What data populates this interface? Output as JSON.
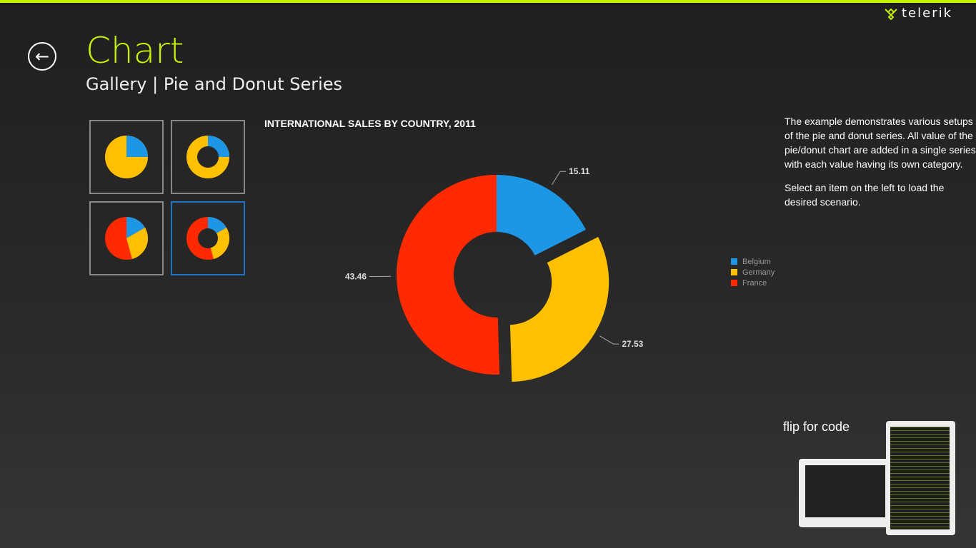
{
  "brand": {
    "name": "telerik",
    "accent": "#c6f400"
  },
  "header": {
    "title": "Chart",
    "subtitle": "Gallery | Pie and Donut Series",
    "back_icon": "arrow-left-circle-icon"
  },
  "gallery": [
    {
      "name": "pie"
    },
    {
      "name": "donut"
    },
    {
      "name": "pie-three"
    },
    {
      "name": "donut-three",
      "selected": true
    }
  ],
  "description": [
    "The example demonstrates various setups of the pie and donut series. All value of the pie/donut chart are added in a single series with each value having its own category.",
    "Select an item on the left to load the desired scenario."
  ],
  "flip": {
    "label": "flip for code"
  },
  "chart_data": {
    "type": "pie",
    "variant": "donut",
    "title": "INTERNATIONAL SALES BY COUNTRY, 2011",
    "categories": [
      "Belgium",
      "Germany",
      "France"
    ],
    "values": [
      15.11,
      27.53,
      43.46
    ],
    "labels": [
      "15.11",
      "27.53",
      "43.46"
    ],
    "colors": [
      "#1e96e6",
      "#ffc000",
      "#ff2a00"
    ],
    "exploded": [
      "Germany"
    ],
    "legend": "right"
  }
}
